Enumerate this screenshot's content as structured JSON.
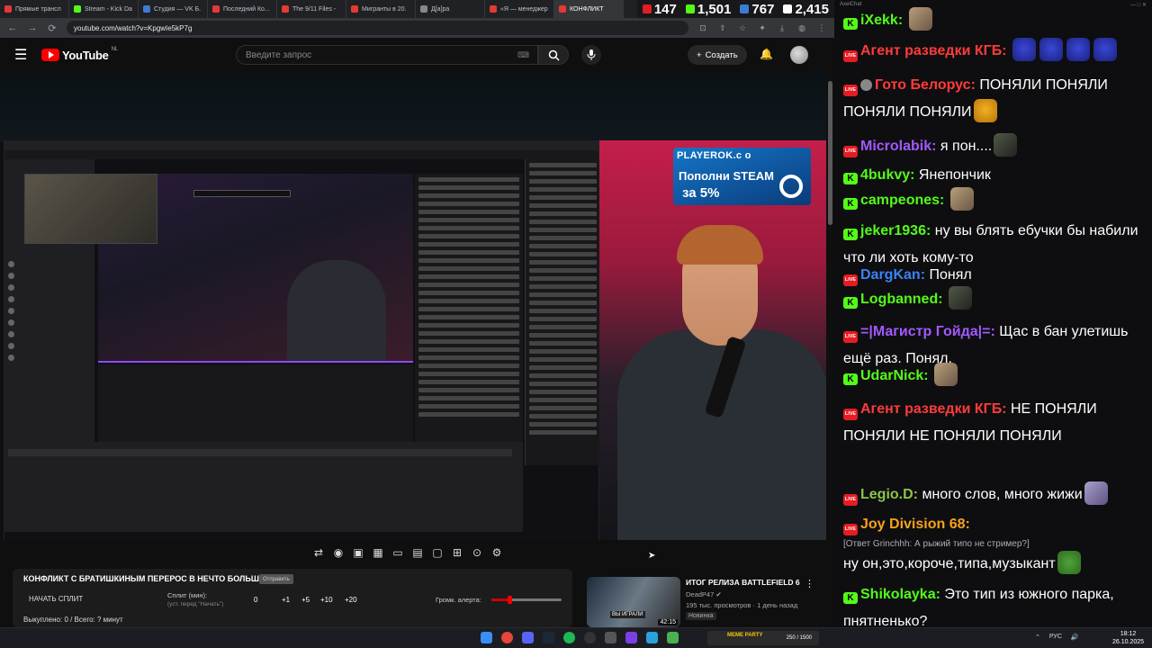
{
  "browser": {
    "tabs": [
      {
        "label": "Прямые трансл",
        "fav": "fav-red"
      },
      {
        "label": "Stream - Kick Da",
        "fav": "fav-green"
      },
      {
        "label": "Студия — VK Б.",
        "fav": "fav-blue"
      },
      {
        "label": "Последний Ко...",
        "fav": "fav-red"
      },
      {
        "label": "The 9/11 Files -",
        "fav": "fav-red"
      },
      {
        "label": "Мигранты в 20.",
        "fav": "fav-red"
      },
      {
        "label": "Д[а]ра",
        "fav": "fav-grey"
      },
      {
        "label": "«Я — менеджер",
        "fav": "fav-red"
      },
      {
        "label": "КОНФЛИКТ",
        "fav": "fav-red"
      }
    ],
    "url": "youtube.com/watch?v=KpgwIe5kP7g"
  },
  "stats": {
    "youtube_viewers": "147",
    "kick_viewers": "1,501",
    "vk_viewers": "767",
    "total_viewers": "2,415"
  },
  "youtube": {
    "logo_text": "YouTube",
    "country": "NL",
    "search_placeholder": "Введите запрос",
    "create_label": "Создать"
  },
  "ad": {
    "brand": "PLAYEROK.c o",
    "line1": "Пополни STEAM",
    "line2": "за 5%"
  },
  "split_panel": {
    "title": "КОНФЛИКТ С БРАТИШКИНЫМ ПЕРЕРОС В НЕЧТО БОЛЬШЕЕ...",
    "badge": "Отправить",
    "start_label": "НАЧАТЬ СПЛИТ",
    "split_label": "Сплит (мин):",
    "split_sub": "(уст. перед \"Начать\")",
    "buttons": [
      "0",
      "+1",
      "+5",
      "+10",
      "+20"
    ],
    "alert_label": "Громк. алерта:",
    "alert_volume": 0.25,
    "footer": "Выкуплено: 0 / Всего: ? минут"
  },
  "recommended": {
    "title": "ИТОГ РЕЛИЗА BATTLEFIELD 6",
    "channel": "DeadP47",
    "meta": "195 тыс. просмотров · 1 день назад",
    "badge": "Новинка",
    "duration": "42:15",
    "thumb_text": "ВЫ ИГРАЛИ"
  },
  "chat": {
    "window_title": "AxelChat",
    "messages": [
      {
        "platform": "kick",
        "user": "iXekk",
        "color": "#53fc18",
        "text": "",
        "emotes": [
          "em-photo"
        ]
      },
      {
        "platform": "yt",
        "user": "Агент разведки КГБ",
        "color": "#ff3b3b",
        "text": "",
        "emotes": [
          "em-blue",
          "em-blue",
          "em-blue",
          "em-blue"
        ]
      },
      {
        "platform": "yt",
        "user": "Гото Белорус",
        "color": "#ff3b3b",
        "verified": true,
        "text": "ПОНЯЛИ ПОНЯЛИ ПОНЯЛИ ПОНЯЛИ"
      },
      {
        "platform": "yt",
        "user": "Microlabik",
        "color": "#a259ff",
        "text": "я пон...."
      },
      {
        "platform": "kick",
        "user": "4bukvy",
        "color": "#53fc18",
        "text": "Янепончик"
      },
      {
        "platform": "kick",
        "user": "campeones",
        "color": "#53fc18",
        "text": ""
      },
      {
        "platform": "kick",
        "user": "jeker1936",
        "color": "#53fc18",
        "text": "ну вы блять ебучки бы набили что ли хоть кому-то"
      },
      {
        "platform": "yt",
        "user": "DargKan",
        "color": "#3b82f6",
        "text": "Понял"
      },
      {
        "platform": "kick",
        "user": "Logbanned",
        "color": "#53fc18",
        "text": ""
      },
      {
        "platform": "yt",
        "user": "=|Магистр Гойда|=",
        "color": "#a259ff",
        "text": "Щас в бан улетишь ещё раз. Понял."
      },
      {
        "platform": "kick",
        "user": "UdarNick",
        "color": "#53fc18",
        "text": ""
      },
      {
        "platform": "yt",
        "user": "Агент разведки КГБ",
        "color": "#ff3b3b",
        "text": "НЕ ПОНЯЛИ ПОНЯЛИ НЕ ПОНЯЛИ ПОНЯЛИ"
      },
      {
        "platform": "yt",
        "user": "Legio.D",
        "color": "#8bc34a",
        "text": "много слов, много жижи"
      },
      {
        "platform": "yt",
        "user": "Joy Division 68",
        "color": "#f7a21b",
        "reply": "[Ответ Grinchhh: А рыжий типо не стример?]",
        "text": "ну он,это,короче,типа,музыкант"
      },
      {
        "platform": "kick",
        "user": "Shikolayka",
        "color": "#53fc18",
        "text": "Это тип из южного парка, пнятненько?"
      }
    ]
  },
  "taskbar": {
    "promo_label": "MEME PARTY",
    "promo_value": "250 / 1500",
    "lang": "РУС",
    "time": "18:12",
    "date": "26.10.2025"
  }
}
